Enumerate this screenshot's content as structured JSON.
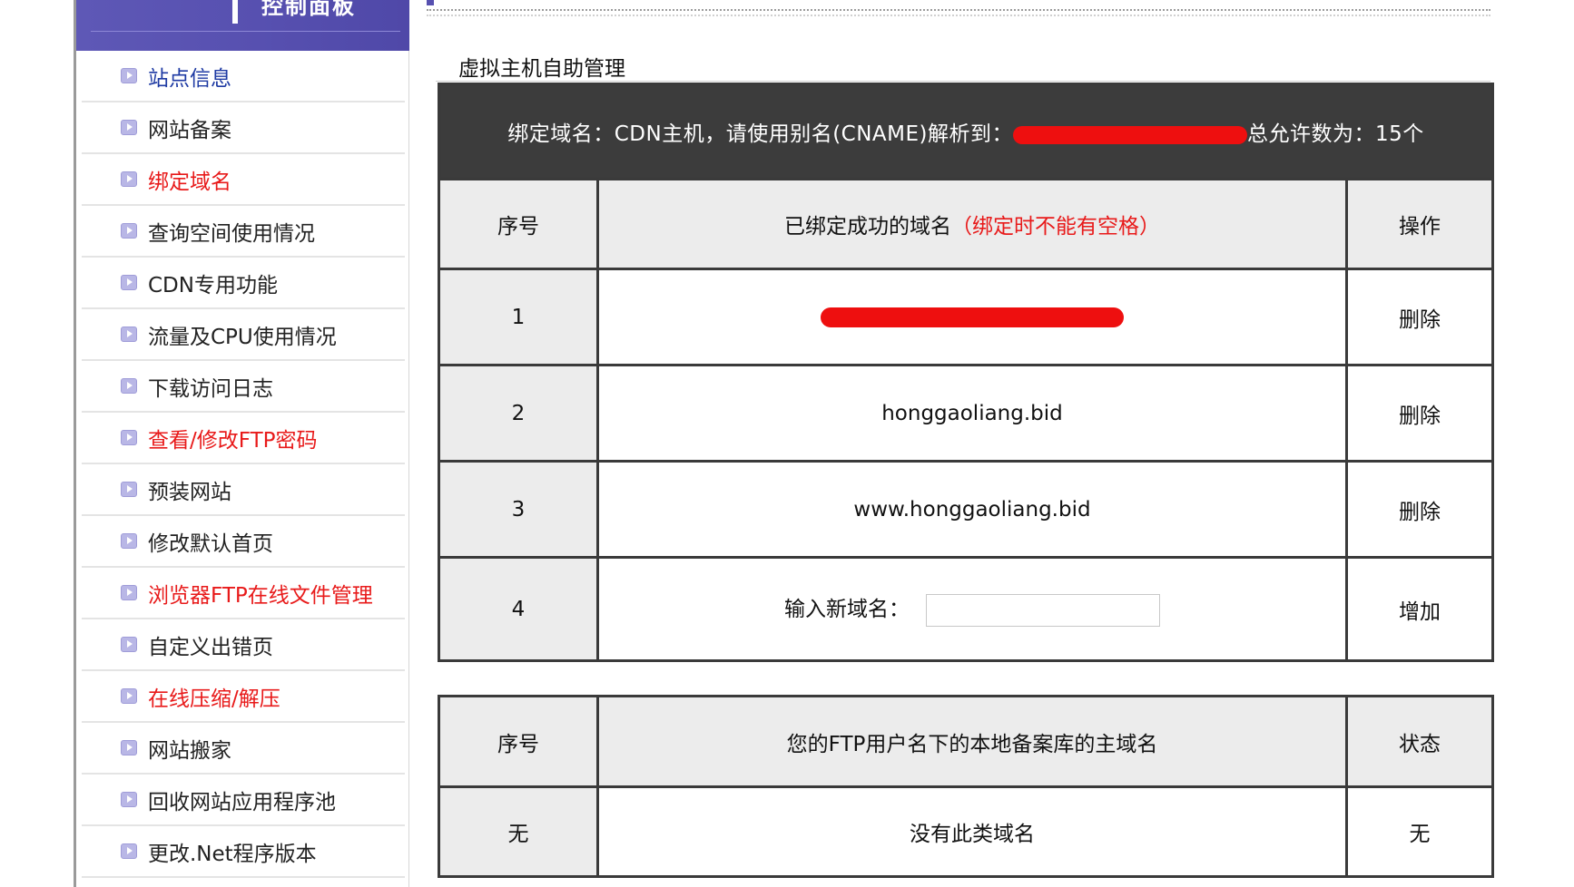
{
  "sidebar": {
    "header_title": "控制面板",
    "items": [
      {
        "label": "站点信息",
        "color": "blue"
      },
      {
        "label": "网站备案",
        "color": "black"
      },
      {
        "label": "绑定域名",
        "color": "red"
      },
      {
        "label": "查询空间使用情况",
        "color": "black"
      },
      {
        "label": "CDN专用功能",
        "color": "black"
      },
      {
        "label": "流量及CPU使用情况",
        "color": "black"
      },
      {
        "label": "下载访问日志",
        "color": "black"
      },
      {
        "label": "查看/修改FTP密码",
        "color": "red"
      },
      {
        "label": "预装网站",
        "color": "black"
      },
      {
        "label": "修改默认首页",
        "color": "black"
      },
      {
        "label": "浏览器FTP在线文件管理",
        "color": "red"
      },
      {
        "label": "自定义出错页",
        "color": "black"
      },
      {
        "label": "在线压缩/解压",
        "color": "red"
      },
      {
        "label": "网站搬家",
        "color": "black"
      },
      {
        "label": "回收网站应用程序池",
        "color": "black"
      },
      {
        "label": "更改.Net程序版本",
        "color": "black"
      }
    ]
  },
  "main": {
    "section_title": "虚拟主机自助管理",
    "banner": {
      "prefix": "绑定域名：CDN主机，请使用别名(CNAME)解析到：",
      "suffix": "总允许数为：15个"
    },
    "bound_table": {
      "col_index": "序号",
      "col_domain": "已绑定成功的域名",
      "col_domain_hint": "（绑定时不能有空格）",
      "col_action": "操作",
      "rows": [
        {
          "index": "1",
          "domain": "",
          "action": "删除"
        },
        {
          "index": "2",
          "domain": "honggaoliang.bid",
          "action": "删除"
        },
        {
          "index": "3",
          "domain": "www.honggaoliang.bid",
          "action": "删除"
        }
      ],
      "new_row": {
        "index": "4",
        "label": "输入新域名：",
        "input_value": "",
        "action": "增加"
      }
    },
    "ftp_table": {
      "col_index": "序号",
      "col_domain": "您的FTP用户名下的本地备案库的主域名",
      "col_status": "状态",
      "row": {
        "index": "无",
        "domain": "没有此类域名",
        "status": "无"
      }
    }
  },
  "colors": {
    "header_purple": "#5750b0",
    "link_blue": "#1e3aa3",
    "highlight_red": "#e81a1a",
    "banner_dark": "#3c3c3c",
    "redaction_red": "#ee0f0f"
  }
}
